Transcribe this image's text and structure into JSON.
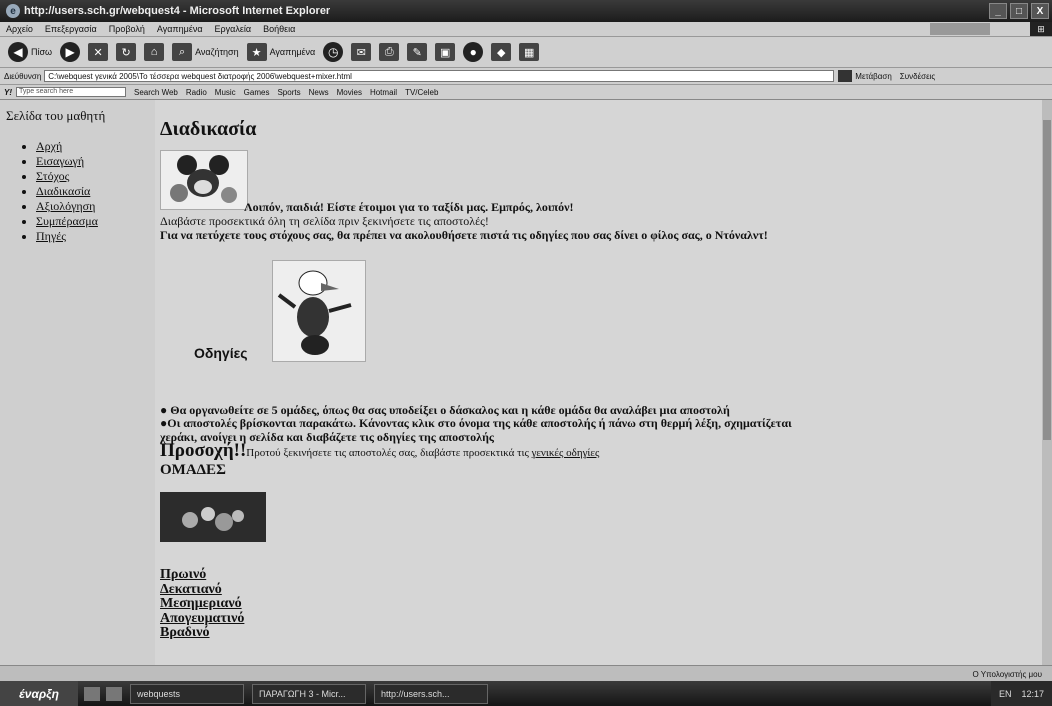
{
  "window": {
    "title": "http://users.sch.gr/webquest4 - Microsoft Internet Explorer",
    "minimize": "_",
    "maximize": "□",
    "close": "X"
  },
  "menu": [
    "Αρχείο",
    "Επεξεργασία",
    "Προβολή",
    "Αγαπημένα",
    "Εργαλεία",
    "Βοήθεια"
  ],
  "toolbar": {
    "back": "Πίσω",
    "search": "Αναζήτηση",
    "favorites": "Αγαπημένα"
  },
  "address": {
    "label": "Διεύθυνση",
    "value": "C:\\webquest γενικά 2005\\Το τέσσερα webquest διατροφής 2006\\webquest+mixer.html",
    "go": "Μετάβαση",
    "links": "Συνδέσεις"
  },
  "links_bar": {
    "logo": "Y!",
    "search_placeholder": "Type search here",
    "items": [
      "Search Web",
      "Radio",
      "Music",
      "Games",
      "Sports",
      "News",
      "Movies",
      "Hotmail",
      "TV/Celeb"
    ]
  },
  "sidebar": {
    "title": "Σελίδα του μαθητή",
    "items": [
      "Αρχή",
      "Εισαγωγή",
      "Στόχος",
      "Διαδικασία",
      "Αξιολόγηση",
      "Συμπέρασμα",
      "Πηγές"
    ]
  },
  "main": {
    "heading": "Διαδικασία",
    "ready": "Λοιπόν, παιδιά! Είστε έτοιμοι για το ταξίδι μας. Εμπρός, λοιπόν!",
    "read_page": "Διαβάστε προσεκτικά όλη τη σελίδα πριν ξεκινήσετε τις αποστολές!",
    "goal": "Για να πετύχετε τους στόχους σας, θα πρέπει να ακολουθήσετε πιστά τις οδηγίες που σας δίνει ο φίλος σας, ο Ντόναλντ!",
    "instructions_heading": "Οδηγίες",
    "bullet1": "● Θα οργανωθείτε σε 5 ομάδες, όπως θα σας υποδείξει ο δάσκαλος και η κάθε ομάδα θα αναλάβει μια αποστολή",
    "bullet2a": "●Οι αποστολές βρίσκονται παρακάτω. Κάνοντας κλικ στο όνομα της κάθε αποστολής ή πάνω στη θερμή λέξη, σχηματίζεται",
    "bullet2b": "χεράκι, ανοίγει η σελίδα και διαβάζετε τις οδηγίες της αποστολής",
    "attention_big": "Προσοχή!!",
    "attention_text": "Προτού ξεκινήσετε τις αποστολές σας, διαβάστε προσεκτικά τις ",
    "attention_link": "γενικές οδηγίες",
    "groups_heading": "ΟΜΑΔΕΣ",
    "groups": [
      "Πρωινό",
      "Δεκατιανό",
      "Μεσημεριανό",
      "Απογευματινό",
      "Βραδινό"
    ]
  },
  "status": {
    "zone": "Ο Υπολογιστής μου"
  },
  "taskbar": {
    "start": "έναρξη",
    "tasks": [
      "webquests",
      "ΠΑΡΑΓΩΓΗ 3 - Micr...",
      "http://users.sch..."
    ],
    "lang": "EN",
    "clock": "12:17"
  }
}
